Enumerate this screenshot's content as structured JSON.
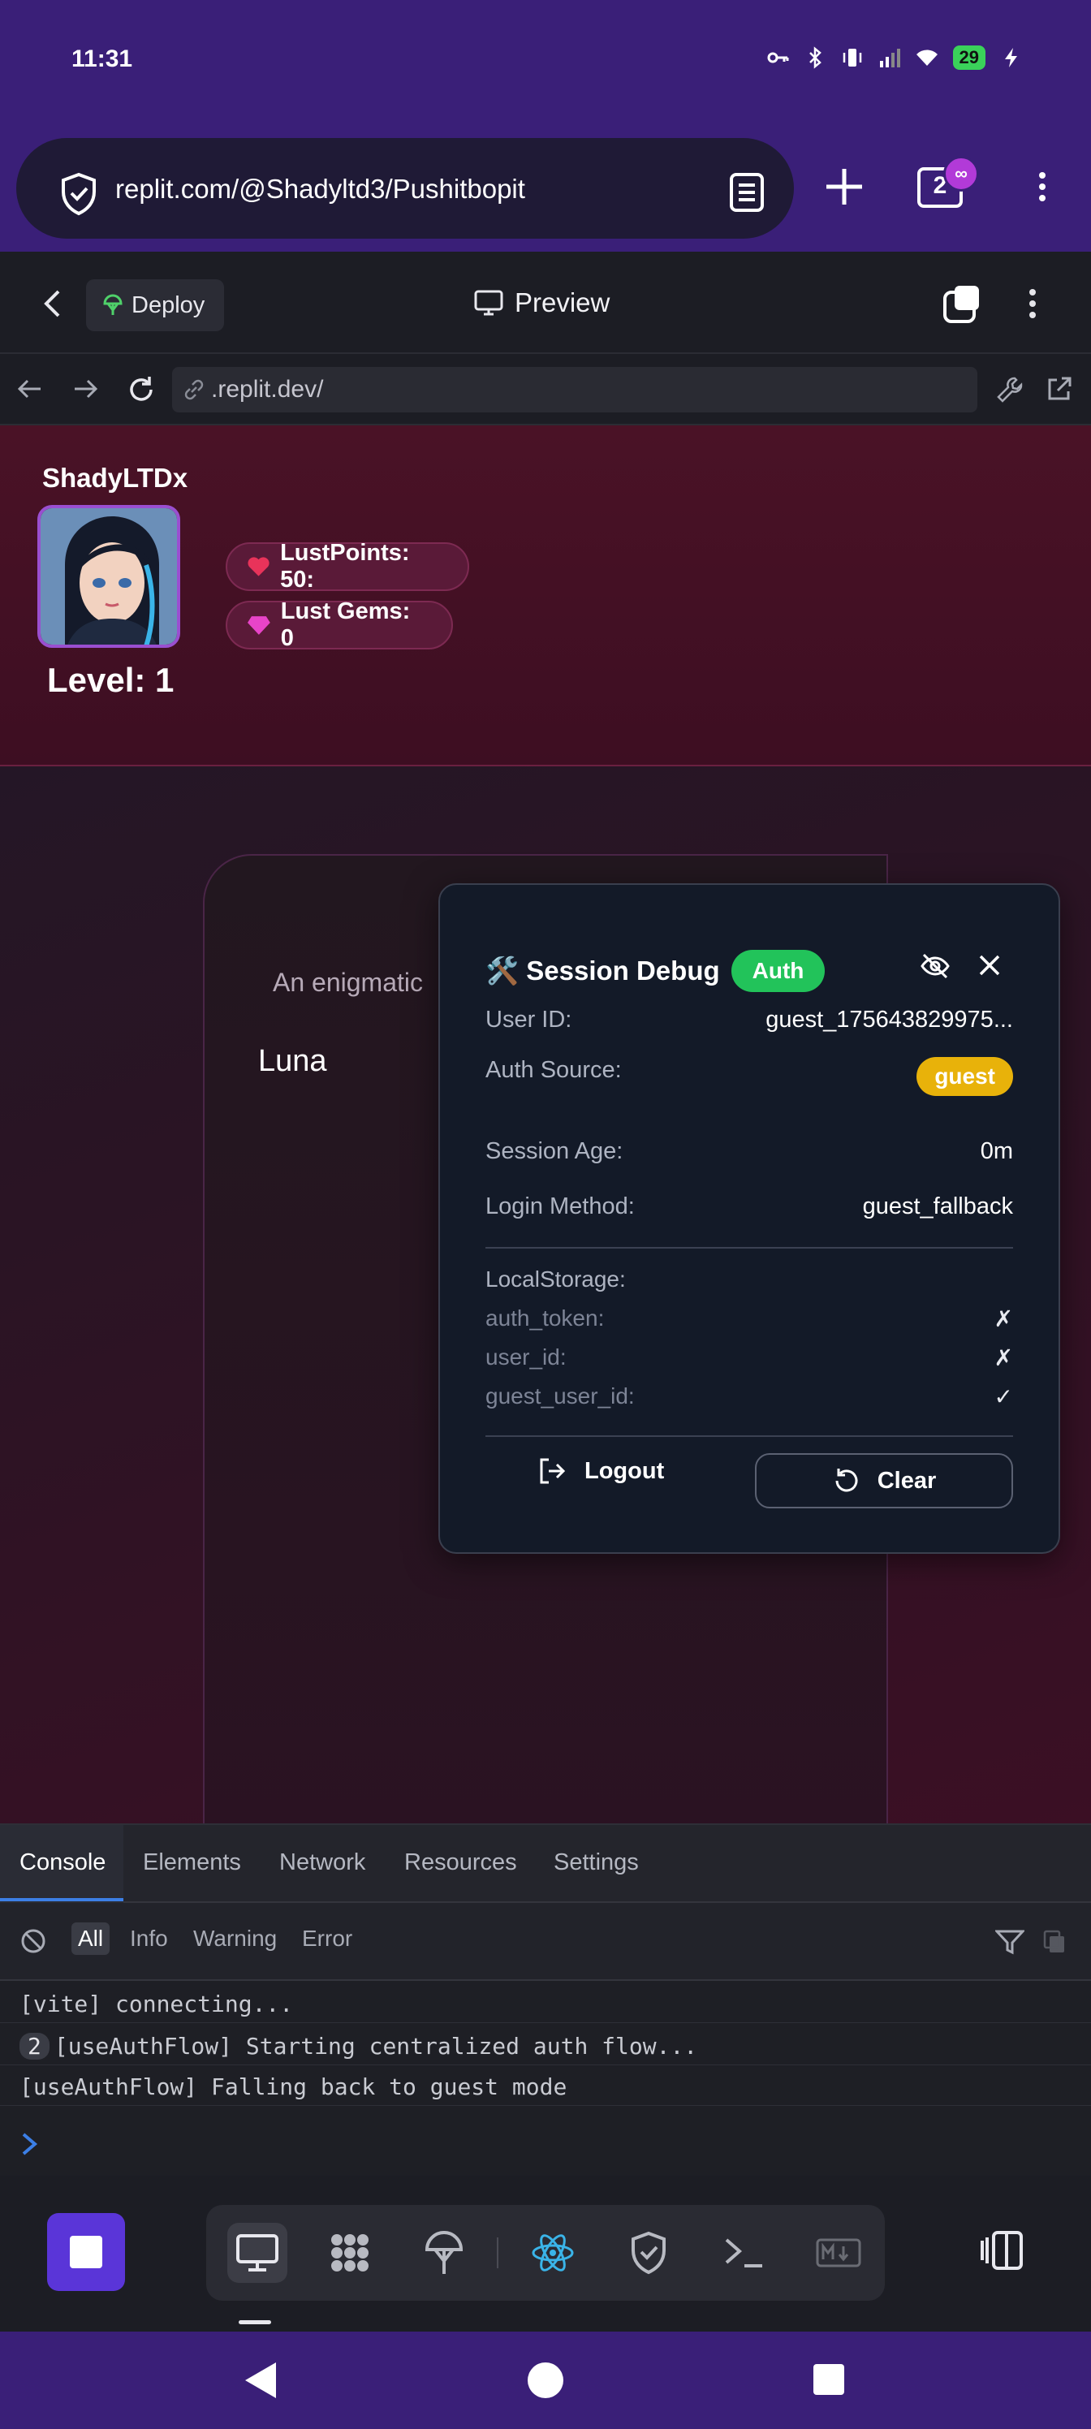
{
  "status_bar": {
    "time": "11:31",
    "battery": "29"
  },
  "browser": {
    "url": "replit.com/@Shadyltd3/Pushitbopit",
    "tab_count": "2",
    "tab_badge": "∞"
  },
  "replit_bar": {
    "deploy_label": "Deploy",
    "preview_label": "Preview"
  },
  "preview_nav": {
    "address": ".replit.dev/"
  },
  "app": {
    "username": "ShadyLTDx",
    "level": "Level: 1",
    "lust_points": "LustPoints: 50:",
    "lust_gems": "Lust Gems: 0",
    "card_description": "An enigmatic",
    "card_name": "Luna"
  },
  "debug": {
    "title": "🛠️ Session Debug",
    "auth_badge": "Auth",
    "rows": [
      {
        "key": "User ID:",
        "value": "guest_175643829975..."
      },
      {
        "key": "Auth Source:",
        "value": "guest"
      },
      {
        "key": "Session Age:",
        "value": "0m"
      },
      {
        "key": "Login Method:",
        "value": "guest_fallback"
      }
    ],
    "local_storage_title": "LocalStorage:",
    "local_storage": [
      {
        "key": "auth_token:",
        "value": "✗"
      },
      {
        "key": "user_id:",
        "value": "✗"
      },
      {
        "key": "guest_user_id:",
        "value": "✓"
      }
    ],
    "logout_label": "Logout",
    "clear_label": "Clear"
  },
  "devtools": {
    "tabs": [
      "Console",
      "Elements",
      "Network",
      "Resources",
      "Settings"
    ],
    "filters": [
      "All",
      "Info",
      "Warning",
      "Error"
    ],
    "logs": [
      {
        "count": "",
        "text": "[vite] connecting..."
      },
      {
        "count": "2",
        "text": "[useAuthFlow] Starting centralized auth flow..."
      },
      {
        "count": "",
        "text": "[useAuthFlow] Falling back to guest mode"
      }
    ]
  },
  "colors": {
    "status_purple": "#3a1f78",
    "auth_green": "#22c35a",
    "guest_yellow": "#e8b20a",
    "accent_purple": "#5a35d8",
    "devtools_blue": "#3c7fe6"
  }
}
